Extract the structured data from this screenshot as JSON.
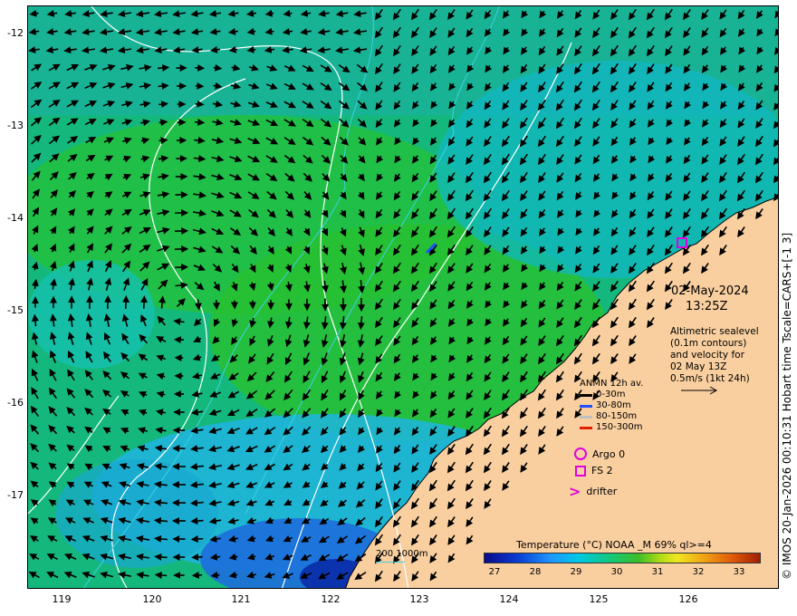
{
  "map": {
    "y_ticks": [
      "-12",
      "-13",
      "-14",
      "-15",
      "-16",
      "-17"
    ],
    "x_ticks": [
      "119",
      "120",
      "121",
      "122",
      "123",
      "124",
      "125",
      "126"
    ],
    "date_line1": "02-May-2024",
    "date_line2": "13:25Z",
    "info_lines": [
      "Altimetric sealevel",
      "(0.1m contours)",
      "and velocity for",
      "02 May 13Z",
      "0.5m/s (1kt 24h)"
    ],
    "side_credit": "© IMOS 20-Jan-2026 00:10:31 Hobart time Tscale=CARS+[-1 3]",
    "scale_text": "200  1000m",
    "legend": {
      "title": "ANMN 12h av.",
      "rows": [
        {
          "label": "0-30m",
          "color": "#000000"
        },
        {
          "label": "30-80m",
          "color": "#1e50ff"
        },
        {
          "label": "80-150m",
          "color": "#c0c0c0"
        },
        {
          "label": "150-300m",
          "color": "#e01e00"
        }
      ]
    },
    "symbols": {
      "argo": "Argo 0",
      "fs": "FS 2",
      "drifter": "drifter",
      "symbol_color": "#e000e0"
    },
    "colorbar": {
      "title": "Temperature (°C) NOAA _M 69% ql>=4",
      "ticks": [
        "27",
        "28",
        "29",
        "30",
        "31",
        "32",
        "33"
      ]
    },
    "colors": {
      "land": "#f9cfa0",
      "contour": "#ffffff",
      "bathy": "#3cd0e0"
    }
  }
}
